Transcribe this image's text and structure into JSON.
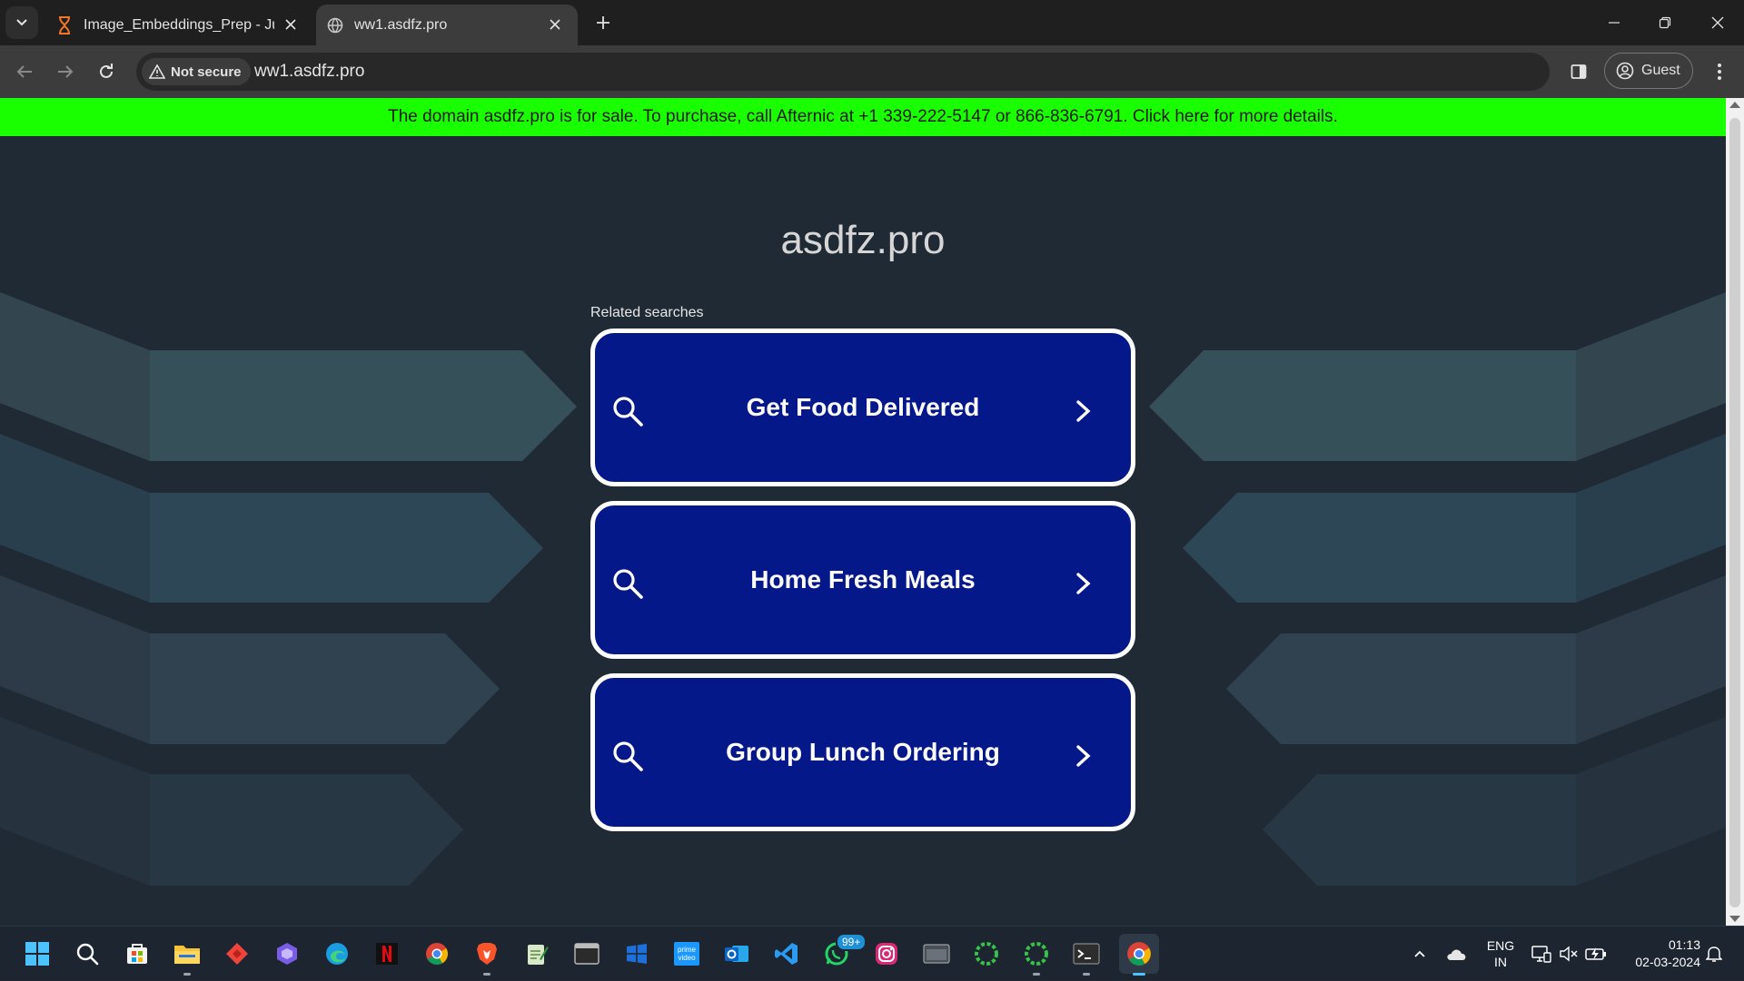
{
  "browser": {
    "tabs": [
      {
        "title": "Image_Embeddings_Prep - Jupyter",
        "active": false
      },
      {
        "title": "ww1.asdfz.pro",
        "active": true
      }
    ],
    "security_label": "Not secure",
    "url": "ww1.asdfz.pro",
    "profile_label": "Guest"
  },
  "page": {
    "banner": "The domain asdfz.pro is for sale. To purchase, call Afternic at +1 339-222-5147 or 866-836-6791. Click here for more details.",
    "site_title": "asdfz.pro",
    "related_label": "Related searches",
    "searches": [
      {
        "label": "Get Food Delivered"
      },
      {
        "label": "Home Fresh Meals"
      },
      {
        "label": "Group Lunch Ordering"
      }
    ],
    "colors": {
      "banner": "#1aff00",
      "card": "#041889",
      "background": "#1f2a35"
    }
  },
  "taskbar": {
    "apps": [
      "start-icon",
      "search-icon",
      "store-icon",
      "file-explorer-icon",
      "anydesk-icon",
      "copilot-icon",
      "edge-icon",
      "netflix-icon",
      "chrome-icon",
      "brave-icon",
      "notepad-icon",
      "terminal-icon",
      "windows-store-icon",
      "prime-video-icon",
      "outlook-icon",
      "vscode-icon",
      "whatsapp-icon",
      "instagram-icon",
      "app-window-icon",
      "loader-app-icon",
      "loader-app-2-icon",
      "terminal-2-icon",
      "chrome-active-icon"
    ],
    "whatsapp_badge": "99+",
    "language_line1": "ENG",
    "language_line2": "IN",
    "time": "01:13",
    "date": "02-03-2024"
  }
}
